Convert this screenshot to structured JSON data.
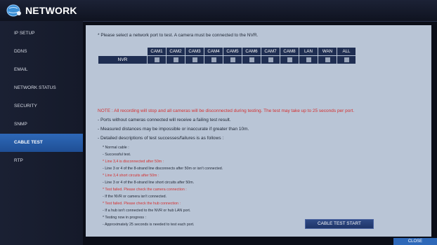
{
  "header": {
    "title": "NETWORK",
    "logo_icon": "network-globe-icon"
  },
  "sidebar": {
    "items": [
      {
        "label": "IP SETUP",
        "active": false
      },
      {
        "label": "DDNS",
        "active": false
      },
      {
        "label": "EMAIL",
        "active": false
      },
      {
        "label": "NETWORK STATUS",
        "active": false
      },
      {
        "label": "SECURITY",
        "active": false
      },
      {
        "label": "SNMP",
        "active": false
      },
      {
        "label": "CABLE TEST",
        "active": true
      },
      {
        "label": "RTP",
        "active": false
      }
    ]
  },
  "main": {
    "prompt": "* Please select a network port to test. A camera must be connected to the NVR.",
    "ports": {
      "row_label": "NVR",
      "columns": [
        "CAM1",
        "CAM2",
        "CAM3",
        "CAM4",
        "CAM5",
        "CAM6",
        "CAM7",
        "CAM8",
        "LAN",
        "WAN",
        "ALL"
      ]
    },
    "note": "NOTE : All recording will stop and all cameras will be disconnected during testing. The test may take up to 25 seconds per port.",
    "info": [
      "- Ports without cameras connected will receive a failing test result.",
      "- Measured distances may be impossible or inaccurate if greater than 10m.",
      "- Detailed descriptions of test successes/failures is as follows :"
    ],
    "details": [
      {
        "text": "* Normal cable :",
        "red": false
      },
      {
        "text": "- Successful test.",
        "red": false
      },
      {
        "text": "* Line 3,4 is disconnected after 50m :",
        "red": true
      },
      {
        "text": "- Line 3 or 4 of the 8-strand line disconnects after 50m or isn't connected.",
        "red": false
      },
      {
        "text": "* Line 3,4 short circuits after 50m :",
        "red": true
      },
      {
        "text": "- Line 3 or 4 of the 8-strand line short circuits after 50m.",
        "red": false
      },
      {
        "text": "* Test failed. Please check the camera connection :",
        "red": true
      },
      {
        "text": "- If the NVR or camera isn't connected.",
        "red": false
      },
      {
        "text": "* Test failed. Please check the hub connection :",
        "red": true
      },
      {
        "text": "- If a hub isn't connected to the NVR or hub LAN port.",
        "red": false
      },
      {
        "text": "* Testing now in progress :",
        "red": false
      },
      {
        "text": "- Approximately 25 seconds is needed to test each port.",
        "red": false
      }
    ],
    "test_button": "CABLE TEST START"
  },
  "footer": {
    "close_label": "CLOSE"
  },
  "colors": {
    "accent": "#2e68b8",
    "warning": "#d43030",
    "panel": "#b9c5d6"
  }
}
